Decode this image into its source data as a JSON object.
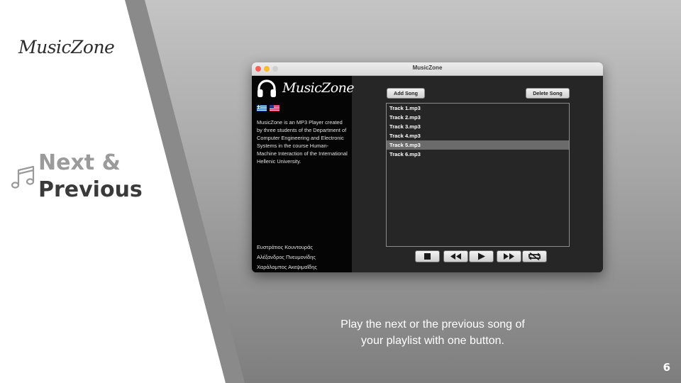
{
  "slide": {
    "brand": "MusicZone",
    "section_title_line1": "Next &",
    "section_title_line2": "Previous",
    "caption_line1": "Play the next or the previous song of",
    "caption_line2": "your playlist with one button.",
    "page_number": "6",
    "section_icon": "music-note-icon"
  },
  "window": {
    "title": "MusicZone",
    "sidebar": {
      "logo_text": "MusicZone",
      "logo_icon": "headphones-icon",
      "languages": [
        "Greek flag",
        "US flag"
      ],
      "about_text": "MusicZone is an MP3 Player created by three students of the Department of Computer Engineering and Electronic Systems in the course Human-Machine Interaction of the International Hellenic University.",
      "authors": [
        "Ευστράτιος Κουντουράς",
        "Αλέξανδρος Πνευμονίδης",
        "Χαράλαμπος Ακεψιμαΐδης"
      ]
    },
    "toolbar": {
      "add_label": "Add Song",
      "delete_label": "Delete Song"
    },
    "playlist": {
      "tracks": [
        "Track 1.mp3",
        "Track 2.mp3",
        "Track 3.mp3",
        "Track 4.mp3",
        "Track 5.mp3",
        "Track 6.mp3"
      ],
      "selected_index": 4
    },
    "controls": [
      "stop-icon",
      "previous-icon",
      "play-icon",
      "next-icon",
      "repeat-icon"
    ]
  },
  "colors": {
    "sidebar_bg": "#050505",
    "window_bg": "#262626",
    "selected_row": "#6b6b6b",
    "title_accent": "#9b9b9b"
  }
}
